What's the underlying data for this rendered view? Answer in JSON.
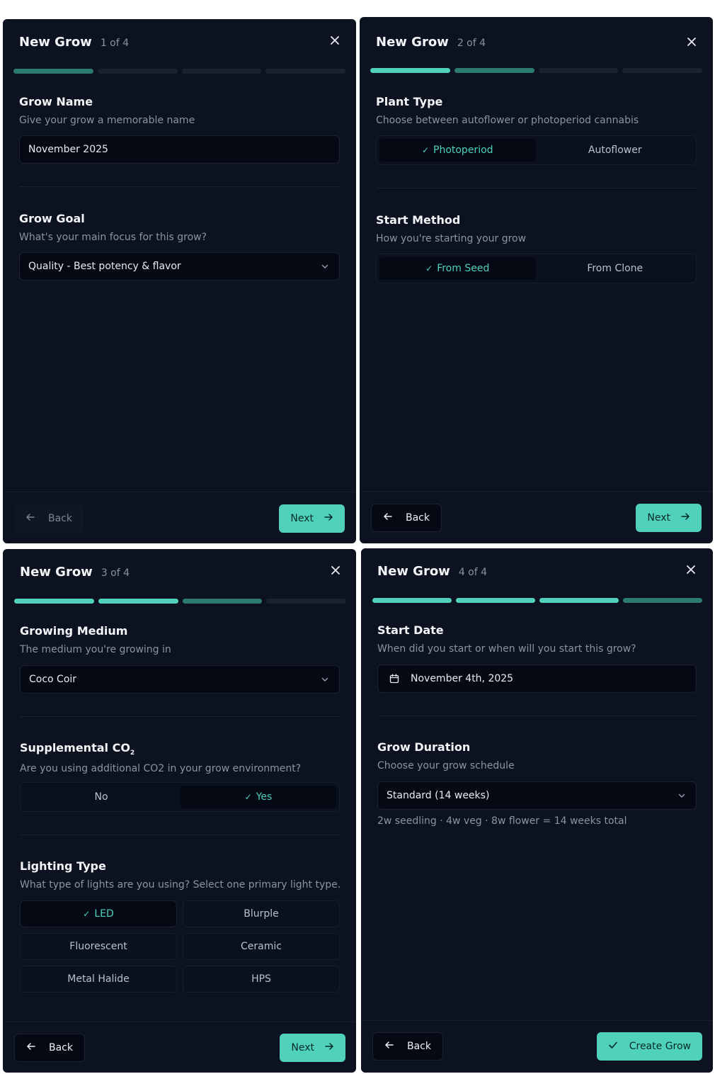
{
  "panels": [
    {
      "title": "New Grow",
      "step": "1 of 4",
      "grow_name": {
        "title": "Grow Name",
        "desc": "Give your grow a memorable name",
        "value": "November 2025"
      },
      "grow_goal": {
        "title": "Grow Goal",
        "desc": "What's your main focus for this grow?",
        "value": "Quality - Best potency & flavor"
      },
      "back_label": "Back",
      "next_label": "Next"
    },
    {
      "title": "New Grow",
      "step": "2 of 4",
      "plant_type": {
        "title": "Plant Type",
        "desc": "Choose between autoflower or photoperiod cannabis",
        "options": [
          "Photoperiod",
          "Autoflower"
        ],
        "selected": "Photoperiod"
      },
      "start_method": {
        "title": "Start Method",
        "desc": "How you're starting your grow",
        "options": [
          "From Seed",
          "From Clone"
        ],
        "selected": "From Seed"
      },
      "back_label": "Back",
      "next_label": "Next"
    },
    {
      "title": "New Grow",
      "step": "3 of 4",
      "medium": {
        "title": "Growing Medium",
        "desc": "The medium you're growing in",
        "value": "Coco Coir"
      },
      "co2": {
        "title": "Supplemental CO",
        "title_sub": "2",
        "desc": "Are you using additional CO2 in your grow environment?",
        "options": [
          "No",
          "Yes"
        ],
        "selected": "Yes"
      },
      "lighting": {
        "title": "Lighting Type",
        "desc": "What type of lights are you using? Select one primary light type.",
        "options": [
          "LED",
          "Blurple",
          "Fluorescent",
          "Ceramic",
          "Metal Halide",
          "HPS"
        ],
        "selected": "LED"
      },
      "back_label": "Back",
      "next_label": "Next"
    },
    {
      "title": "New Grow",
      "step": "4 of 4",
      "start_date": {
        "title": "Start Date",
        "desc": "When did you start or when will you start this grow?",
        "value": "November 4th, 2025"
      },
      "duration": {
        "title": "Grow Duration",
        "desc": "Choose your grow schedule",
        "value": "Standard (14 weeks)",
        "summary": "2w seedling · 4w veg · 8w flower = 14 weeks total"
      },
      "back_label": "Back",
      "create_label": "Create Grow"
    }
  ],
  "icons": {
    "close": "close-icon",
    "back": "arrow-left-icon",
    "next": "arrow-right-icon",
    "check": "check-icon",
    "chevron": "chevron-down-icon",
    "calendar": "calendar-icon"
  },
  "colors": {
    "accent": "#4fd1bb",
    "panel_bg": "#0c1220",
    "input_bg": "#050914"
  }
}
